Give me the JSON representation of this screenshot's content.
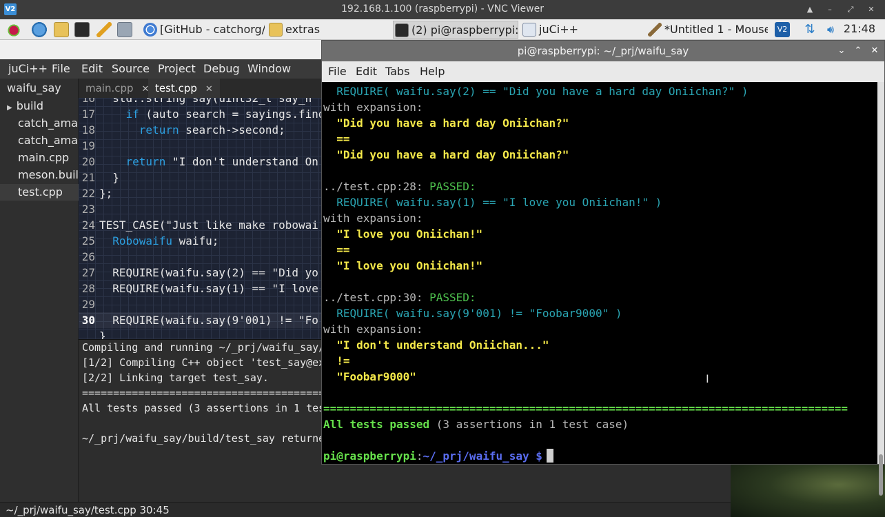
{
  "vnc": {
    "title": "192.168.1.100 (raspberrypi) - VNC Viewer",
    "logo": "V2",
    "controls": [
      "▲",
      "–",
      "⤢",
      "✕"
    ]
  },
  "taskbar": {
    "tasks": [
      {
        "label": "[GitHub - catchorg/...",
        "icon": "chromium-icon",
        "active": false
      },
      {
        "label": "extras",
        "icon": "folder-icon",
        "active": false
      },
      {
        "label": "(2) pi@raspberrypi: ...",
        "icon": "terminal-icon",
        "active": true
      },
      {
        "label": "juCi++",
        "icon": "window-icon",
        "active": false
      },
      {
        "label": "*Untitled 1 - Mouse...",
        "icon": "pencil-icon",
        "active": false
      }
    ],
    "clock": "21:48"
  },
  "juci": {
    "menu": [
      "juCi++",
      "File",
      "Edit",
      "Source",
      "Project",
      "Debug",
      "Window"
    ],
    "project": "waifu_say",
    "tree": [
      "build",
      "catch_amalgamated.cpp",
      "catch_amalgamated.hpp",
      "main.cpp",
      "meson.build",
      "test.cpp"
    ],
    "tabs": [
      {
        "label": "main.cpp",
        "close": "✕"
      },
      {
        "label": "test.cpp",
        "close": "✕"
      }
    ],
    "code": [
      {
        "n": "16",
        "text": "  std::string say(uint32_t say_n"
      },
      {
        "n": "17",
        "pre": "    ",
        "kw": "if",
        "text": " (auto search = sayings.find"
      },
      {
        "n": "18",
        "pre": "      ",
        "kw": "return",
        "text": " search->second;"
      },
      {
        "n": "19",
        "text": ""
      },
      {
        "n": "20",
        "pre": "    ",
        "kw": "return",
        "text": " \"I don't understand On"
      },
      {
        "n": "21",
        "text": "  }"
      },
      {
        "n": "22",
        "text": "};"
      },
      {
        "n": "23",
        "text": ""
      },
      {
        "n": "24",
        "text": "TEST_CASE(\"Just like make robowai"
      },
      {
        "n": "25",
        "pre": "  ",
        "kw": "Robowaifu",
        "text": " waifu;"
      },
      {
        "n": "26",
        "text": ""
      },
      {
        "n": "27",
        "text": "  REQUIRE(waifu.say(2) == \"Did yo"
      },
      {
        "n": "28",
        "text": "  REQUIRE(waifu.say(1) == \"I love"
      },
      {
        "n": "29",
        "text": ""
      },
      {
        "n": "30",
        "text": "  REQUIRE(waifu.say(9'001) != \"Fo"
      },
      {
        "n": "",
        "text": "}"
      }
    ],
    "output": [
      "Compiling and running ~/_prj/waifu_say/",
      "[1/2] Compiling C++ object 'test_say@exe",
      "[2/2] Linking target test_say.",
      "==========================================",
      "All tests passed (3 assertions in 1 test",
      "",
      "~/_prj/waifu_say/build/test_say returned"
    ],
    "status": "~/_prj/waifu_say/test.cpp 30:45"
  },
  "terminal": {
    "title": "pi@raspberrypi: ~/_prj/waifu_say",
    "menu": [
      "File",
      "Edit",
      "Tabs",
      "Help"
    ],
    "lines": [
      {
        "segs": [
          {
            "c": "cyan",
            "t": "  REQUIRE( waifu.say(2) == \"Did you have a hard day Oniichan?\" )"
          }
        ]
      },
      {
        "segs": [
          {
            "c": "grey",
            "t": "with expansion:"
          }
        ]
      },
      {
        "segs": [
          {
            "c": "yellow",
            "t": "  \"Did you have a hard day Oniichan?\""
          }
        ]
      },
      {
        "segs": [
          {
            "c": "yellow",
            "t": "  =="
          }
        ]
      },
      {
        "segs": [
          {
            "c": "yellow",
            "t": "  \"Did you have a hard day Oniichan?\""
          }
        ]
      },
      {
        "segs": []
      },
      {
        "segs": [
          {
            "c": "grey",
            "t": "../test.cpp:28: "
          },
          {
            "c": "green",
            "t": "PASSED:"
          }
        ]
      },
      {
        "segs": [
          {
            "c": "cyan",
            "t": "  REQUIRE( waifu.say(1) == \"I love you Oniichan!\" )"
          }
        ]
      },
      {
        "segs": [
          {
            "c": "grey",
            "t": "with expansion:"
          }
        ]
      },
      {
        "segs": [
          {
            "c": "yellow",
            "t": "  \"I love you Oniichan!\""
          }
        ]
      },
      {
        "segs": [
          {
            "c": "yellow",
            "t": "  =="
          }
        ]
      },
      {
        "segs": [
          {
            "c": "yellow",
            "t": "  \"I love you Oniichan!\""
          }
        ]
      },
      {
        "segs": []
      },
      {
        "segs": [
          {
            "c": "grey",
            "t": "../test.cpp:30: "
          },
          {
            "c": "green",
            "t": "PASSED:"
          }
        ]
      },
      {
        "segs": [
          {
            "c": "cyan",
            "t": "  REQUIRE( waifu.say(9'001) != \"Foobar9000\" )"
          }
        ]
      },
      {
        "segs": [
          {
            "c": "grey",
            "t": "with expansion:"
          }
        ]
      },
      {
        "segs": [
          {
            "c": "yellow",
            "t": "  \"I don't understand Oniichan...\""
          }
        ]
      },
      {
        "segs": [
          {
            "c": "yellow",
            "t": "  !="
          }
        ]
      },
      {
        "segs": [
          {
            "c": "yellow",
            "t": "  \"Foobar9000\""
          }
        ]
      },
      {
        "segs": []
      },
      {
        "segs": [
          {
            "c": "bgreen",
            "t": "==============================================================================="
          }
        ]
      },
      {
        "segs": [
          {
            "c": "bgreen",
            "t": "All tests passed"
          },
          {
            "c": "grey",
            "t": " (3 assertions in 1 test case)"
          }
        ]
      },
      {
        "segs": []
      },
      {
        "segs": [
          {
            "c": "bgreen",
            "t": "pi@raspberrypi"
          },
          {
            "c": "grey",
            "t": ":"
          },
          {
            "c": "blue",
            "t": "~/_prj/waifu_say $"
          }
        ]
      }
    ]
  }
}
